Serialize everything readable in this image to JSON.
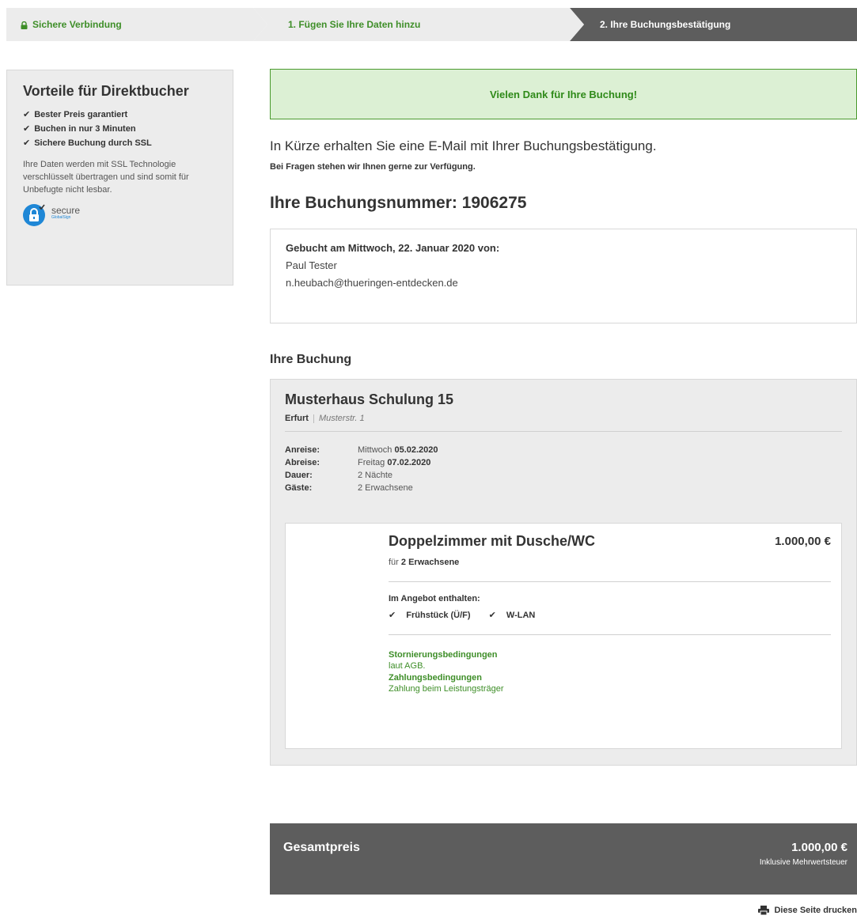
{
  "steps": {
    "secure": "Sichere Verbindung",
    "step1": "1. Fügen Sie Ihre Daten hinzu",
    "step2": "2. Ihre Buchungsbestätigung"
  },
  "sidebar": {
    "title": "Vorteile für Direktbucher",
    "benefits": [
      "Bester Preis garantiert",
      "Buchen in nur 3 Minuten",
      "Sichere Buchung durch SSL"
    ],
    "ssl_text": "Ihre Daten werden mit SSL Technologie verschlüsselt übertragen und sind somit für Unbefugte nicht lesbar.",
    "badge_label": "secure",
    "badge_brand": "GlobalSign"
  },
  "main": {
    "thanks": "Vielen Dank für Ihre Buchung!",
    "lead": "In Kürze erhalten Sie eine E-Mail mit Ihrer Buchungsbestätigung.",
    "sub": "Bei Fragen stehen wir Ihnen gerne zur Verfügung.",
    "booking_number_label": "Ihre Buchungsnummer: 1906275",
    "booked_on": "Gebucht am Mittwoch, 22. Januar 2020 von:",
    "customer_name": "Paul Tester",
    "customer_email": "n.heubach@thueringen-entdecken.de"
  },
  "booking": {
    "section_title": "Ihre Buchung",
    "hotel_name": "Musterhaus Schulung 15",
    "city": "Erfurt",
    "street": "Musterstr. 1",
    "arrival_label": "Anreise:",
    "arrival_day": "Mittwoch",
    "arrival_date": "05.02.2020",
    "departure_label": "Abreise:",
    "departure_day": "Freitag",
    "departure_date": "07.02.2020",
    "duration_label": "Dauer:",
    "duration": "2 Nächte",
    "guests_label": "Gäste:",
    "guests": "2 Erwachsene"
  },
  "room": {
    "name": "Doppelzimmer mit Dusche/WC",
    "price": "1.000,00 €",
    "for_prefix": "für",
    "for_guests": "2 Erwachsene",
    "included_title": "Im Angebot enthalten:",
    "included": [
      "Frühstück (Ü/F)",
      "W-LAN"
    ],
    "cancellation_title": "Stornierungsbedingungen",
    "cancellation": "laut AGB.",
    "payment_title": "Zahlungsbedingungen",
    "payment": "Zahlung beim Leistungsträger"
  },
  "total": {
    "label": "Gesamtpreis",
    "price": "1.000,00 €",
    "note": "Inklusive Mehrwertsteuer"
  },
  "print_label": "Diese Seite drucken",
  "colors": {
    "green": "#3e8e28",
    "light_green": "#dcf0d4",
    "dark_gray": "#5d5d5d",
    "light_gray": "#ececec",
    "badge_blue": "#1f87d6"
  }
}
